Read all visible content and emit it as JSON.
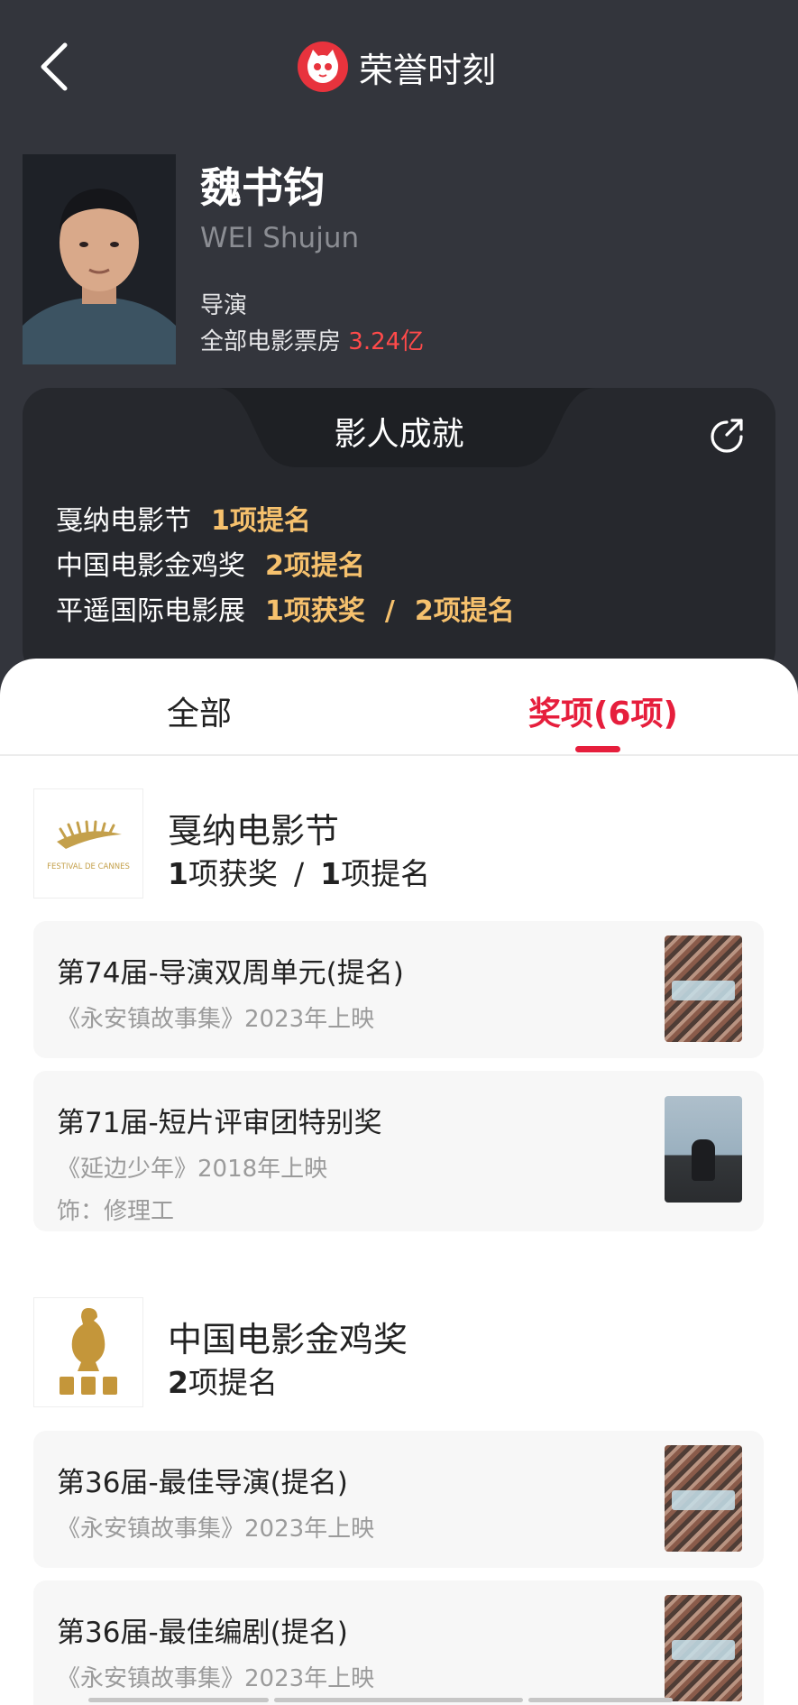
{
  "topbar": {
    "title": "荣誉时刻"
  },
  "person": {
    "name_cn": "魏书钧",
    "name_en": "WEI Shujun",
    "role": "导演",
    "box_office_label": "全部电影票房",
    "box_office_value": "3.24亿"
  },
  "achievements": {
    "title": "影人成就",
    "rows": [
      {
        "festival": "戛纳电影节",
        "parts": [
          "1项提名"
        ]
      },
      {
        "festival": "中国电影金鸡奖",
        "parts": [
          "2项提名"
        ]
      },
      {
        "festival": "平遥国际电影展",
        "parts": [
          "1项获奖",
          "2项提名"
        ]
      }
    ],
    "separator": "/"
  },
  "tabs": {
    "all": "全部",
    "awards": "奖项(6项)"
  },
  "festivals": [
    {
      "name": "戛纳电影节",
      "logo_text": "FESTIVAL DE CANNES",
      "stats": [
        {
          "num": "1",
          "label": "项获奖"
        },
        {
          "num": "1",
          "label": "项提名"
        }
      ],
      "awards": [
        {
          "title": "第74届-导演双周单元(提名)",
          "film": "《永安镇故事集》2023年上映",
          "role": ""
        },
        {
          "title": "第71届-短片评审团特别奖",
          "film": "《延边少年》2018年上映",
          "role": "饰：修理工"
        }
      ]
    },
    {
      "name": "中国电影金鸡奖",
      "logo_text": "",
      "stats": [
        {
          "num": "2",
          "label": "项提名"
        }
      ],
      "awards": [
        {
          "title": "第36届-最佳导演(提名)",
          "film": "《永安镇故事集》2023年上映",
          "role": ""
        },
        {
          "title": "第36届-最佳编剧(提名)",
          "film": "《永安镇故事集》2023年上映",
          "role": ""
        }
      ]
    }
  ],
  "colors": {
    "accent": "#e61e3c",
    "highlight": "#f6c16d",
    "header_bg": "#33353c",
    "box_office": "#ff4a4a"
  },
  "icons": {
    "back": "chevron-left-icon",
    "logo": "cat-logo-icon",
    "share": "share-icon"
  }
}
